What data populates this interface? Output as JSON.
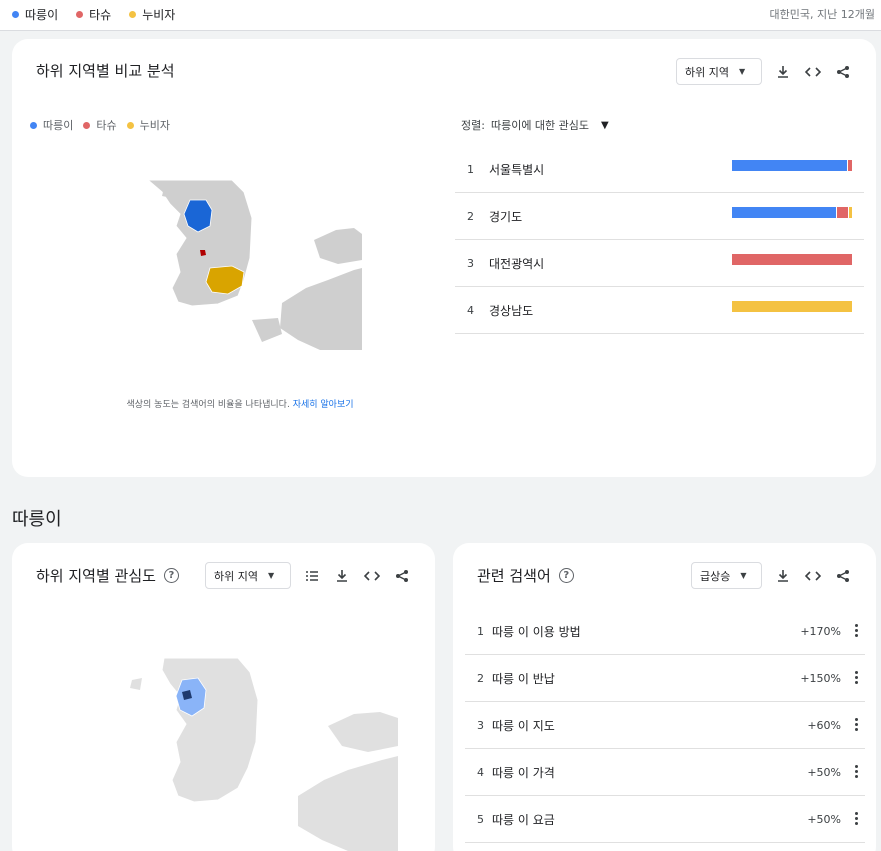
{
  "topbar": {
    "legend": [
      {
        "label": "따릉이",
        "color": "#4285f4"
      },
      {
        "label": "타슈",
        "color": "#e06666"
      },
      {
        "label": "누비자",
        "color": "#f4c242"
      }
    ],
    "scope": "대한민국, 지난 12개월"
  },
  "compare_card": {
    "title": "하위 지역별 비교 분석",
    "dropdown": "하위 지역",
    "legend": [
      {
        "label": "따릉이",
        "color": "#4285f4"
      },
      {
        "label": "타슈",
        "color": "#e06666"
      },
      {
        "label": "누비자",
        "color": "#f4c242"
      }
    ],
    "sort_label": "정렬:",
    "sort_value": "따릉이에 대한 관심도",
    "ranks": [
      {
        "num": "1",
        "name": "서울특별시",
        "shares": [
          0.96,
          0.04,
          0.0
        ]
      },
      {
        "num": "2",
        "name": "경기도",
        "shares": [
          0.87,
          0.1,
          0.03
        ]
      },
      {
        "num": "3",
        "name": "대전광역시",
        "shares": [
          0.0,
          1.0,
          0.0
        ]
      },
      {
        "num": "4",
        "name": "경상남도",
        "shares": [
          0.0,
          0.0,
          1.0
        ]
      }
    ],
    "note": "색상의 농도는 검색어의 비율을 나타냅니다.",
    "note_link": "자세히 알아보기"
  },
  "section": {
    "title": "따릉이"
  },
  "interest_card": {
    "title": "하위 지역별 관심도",
    "dropdown": "하위 지역"
  },
  "related_card": {
    "title": "관련 검색어",
    "dropdown": "급상승",
    "rows": [
      {
        "num": "1",
        "name": "따릉 이 이용 방법",
        "pct": "+170%"
      },
      {
        "num": "2",
        "name": "따릉 이 반납",
        "pct": "+150%"
      },
      {
        "num": "3",
        "name": "따릉 이 지도",
        "pct": "+60%"
      },
      {
        "num": "4",
        "name": "따릉 이 가격",
        "pct": "+50%"
      },
      {
        "num": "5",
        "name": "따릉 이 요금",
        "pct": "+50%"
      }
    ]
  }
}
